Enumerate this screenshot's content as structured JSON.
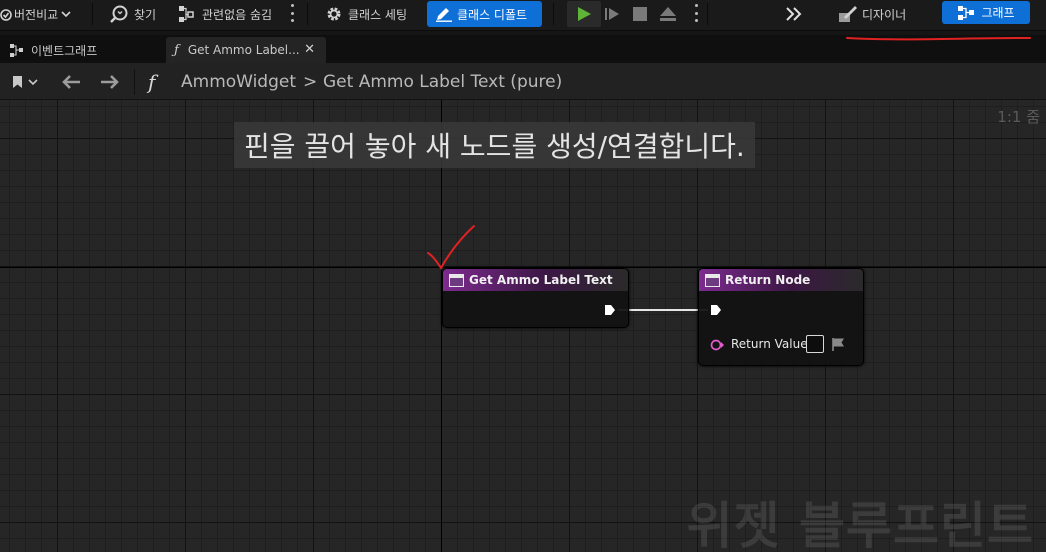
{
  "toolbar": {
    "diff_label": "버전비교",
    "find_label": "찾기",
    "hide_unrelated_label": "관련없음 숨김",
    "class_settings_label": "클래스 세팅",
    "class_defaults_label": "클래스 디폴트",
    "designer_label": "디자이너",
    "graph_label": "그래프",
    "accent": "#0e6fd6",
    "play_color": "#5fb336"
  },
  "doc_tabs": [
    {
      "label": "이벤트그래프",
      "icon": "graph-icon"
    },
    {
      "label": "Get Ammo Label...",
      "icon": "function-icon"
    }
  ],
  "breadcrumb": {
    "function_glyph": "f",
    "owner": "AmmoWidget",
    "separator": ">",
    "function": "Get Ammo Label Text (pure)"
  },
  "canvas": {
    "hint": "핀을 끌어 놓아 새 노드를 생성/연결합니다.",
    "zoom": "1:1 줌",
    "watermark": "위젯 블루프린트"
  },
  "nodes": {
    "entry": {
      "title": "Get Ammo Label Text"
    },
    "return": {
      "title": "Return Node",
      "pin_label": "Return Value"
    }
  },
  "colors": {
    "node_header": "#7d2b8f",
    "string_pin": "#e35ad0"
  }
}
